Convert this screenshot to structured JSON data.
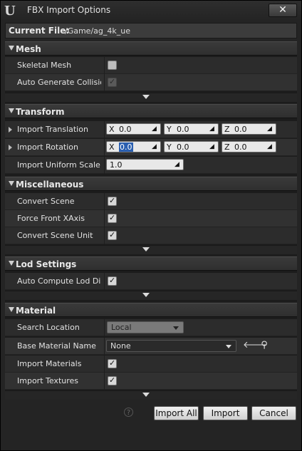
{
  "window": {
    "title": "FBX Import Options",
    "logo_text": "U",
    "close_glyph": "✕"
  },
  "current_file": {
    "label": "Current File:",
    "value": "/Game/ag_4k_ue"
  },
  "sections": {
    "mesh": {
      "title": "Mesh",
      "skeletal_mesh": {
        "label": "Skeletal Mesh",
        "checked": false
      },
      "auto_generate_collision": {
        "label": "Auto Generate Collision",
        "checked": true
      }
    },
    "transform": {
      "title": "Transform",
      "import_translation": {
        "label": "Import Translation",
        "x": "0.0",
        "y": "0.0",
        "z": "0.0"
      },
      "import_rotation": {
        "label": "Import Rotation",
        "x": "0.0",
        "y": "0.0",
        "z": "0.0"
      },
      "import_uniform_scale": {
        "label": "Import Uniform Scale",
        "value": "1.0"
      },
      "axis_x": "X",
      "axis_y": "Y",
      "axis_z": "Z"
    },
    "misc": {
      "title": "Miscellaneous",
      "convert_scene": {
        "label": "Convert Scene",
        "checked": true
      },
      "force_front_xaxis": {
        "label": "Force Front XAxis",
        "checked": true
      },
      "convert_scene_unit": {
        "label": "Convert Scene Unit",
        "checked": true
      }
    },
    "lod": {
      "title": "Lod Settings",
      "auto_compute_lod": {
        "label": "Auto Compute Lod Dista",
        "checked": true
      }
    },
    "material": {
      "title": "Material",
      "search_location": {
        "label": "Search Location",
        "value": "Local"
      },
      "base_material_name": {
        "label": "Base Material Name",
        "value": "None"
      },
      "import_materials": {
        "label": "Import Materials",
        "checked": true
      },
      "import_textures": {
        "label": "Import Textures",
        "checked": true
      }
    }
  },
  "buttons": {
    "import_all": "Import All",
    "import": "Import",
    "cancel": "Cancel",
    "help": "?"
  },
  "icons": {
    "check": "✓",
    "spin": "◢",
    "back_arrow": "🡐",
    "browse": "⚲"
  }
}
